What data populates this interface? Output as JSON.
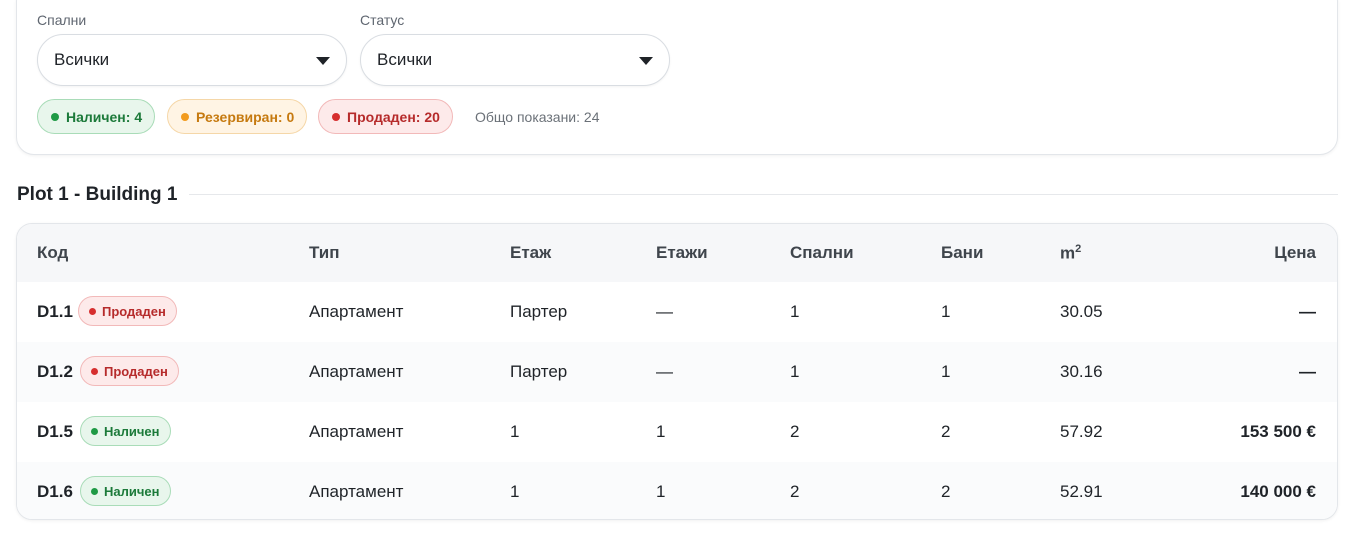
{
  "filters": {
    "bedrooms_label": "Спални",
    "bedrooms_value": "Всички",
    "status_label": "Статус",
    "status_value": "Всички",
    "pills": {
      "available": "Наличен: 4",
      "reserved": "Резервиран: 0",
      "sold": "Продаден: 20"
    },
    "total": "Общо показани: 24"
  },
  "section": {
    "title": "Plot 1 - Building 1"
  },
  "table": {
    "headers": {
      "code": "Код",
      "type": "Тип",
      "floor": "Етаж",
      "floors": "Етажи",
      "bedrooms": "Спални",
      "baths": "Бани",
      "area": "m",
      "area_sup": "2",
      "price": "Цена"
    },
    "rows": [
      {
        "code": "D1.1",
        "status": "Продаден",
        "type": "Апартамент",
        "floor": "Партер",
        "floors": "—",
        "bedrooms": "1",
        "baths": "1",
        "area": "30.05",
        "price": "—"
      },
      {
        "code": "D1.2",
        "status": "Продаден",
        "type": "Апартамент",
        "floor": "Партер",
        "floors": "—",
        "bedrooms": "1",
        "baths": "1",
        "area": "30.16",
        "price": "—"
      },
      {
        "code": "D1.5",
        "status": "Наличен",
        "type": "Апартамент",
        "floor": "1",
        "floors": "1",
        "bedrooms": "2",
        "baths": "2",
        "area": "57.92",
        "price": "153 500 €"
      },
      {
        "code": "D1.6",
        "status": "Наличен",
        "type": "Апартамент",
        "floor": "1",
        "floors": "1",
        "bedrooms": "2",
        "baths": "2",
        "area": "52.91",
        "price": "140 000 €"
      }
    ]
  },
  "colors": {
    "available": "#1f9a45",
    "reserved": "#f29b1e",
    "sold": "#d62f2f"
  }
}
